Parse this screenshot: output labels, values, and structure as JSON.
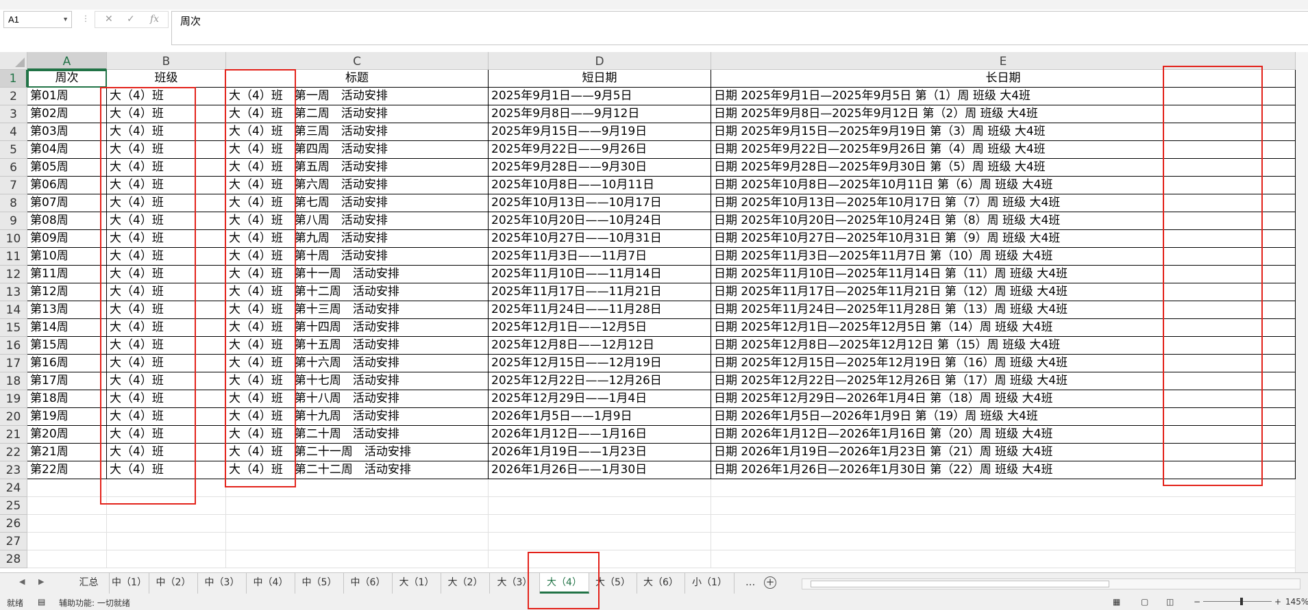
{
  "formula_bar": {
    "name_box": "A1",
    "cancel_icon": "✕",
    "enter_icon": "✓",
    "fx_label": "fx",
    "content": "周次"
  },
  "columns": [
    "A",
    "B",
    "C",
    "D",
    "E"
  ],
  "headers": {
    "a": "周次",
    "b": "班级",
    "c": "标题",
    "d": "短日期",
    "e": "长日期"
  },
  "rows": [
    {
      "a": "第01周",
      "b": "大（4）班",
      "c": "大（4）班　第一周　活动安排",
      "d": "2025年9月1日——9月5日",
      "e": "日期  2025年9月1日—2025年9月5日              第（1）周              班级     大4班"
    },
    {
      "a": "第02周",
      "b": "大（4）班",
      "c": "大（4）班　第二周　活动安排",
      "d": "2025年9月8日——9月12日",
      "e": "日期  2025年9月8日—2025年9月12日              第（2）周              班级     大4班"
    },
    {
      "a": "第03周",
      "b": "大（4）班",
      "c": "大（4）班　第三周　活动安排",
      "d": "2025年9月15日——9月19日",
      "e": "日期  2025年9月15日—2025年9月19日              第（3）周              班级     大4班"
    },
    {
      "a": "第04周",
      "b": "大（4）班",
      "c": "大（4）班　第四周　活动安排",
      "d": "2025年9月22日——9月26日",
      "e": "日期  2025年9月22日—2025年9月26日              第（4）周              班级     大4班"
    },
    {
      "a": "第05周",
      "b": "大（4）班",
      "c": "大（4）班　第五周　活动安排",
      "d": "2025年9月28日——9月30日",
      "e": "日期  2025年9月28日—2025年9月30日              第（5）周              班级     大4班"
    },
    {
      "a": "第06周",
      "b": "大（4）班",
      "c": "大（4）班　第六周　活动安排",
      "d": "2025年10月8日——10月11日",
      "e": "日期  2025年10月8日—2025年10月11日              第（6）周              班级     大4班"
    },
    {
      "a": "第07周",
      "b": "大（4）班",
      "c": "大（4）班　第七周　活动安排",
      "d": "2025年10月13日——10月17日",
      "e": "日期  2025年10月13日—2025年10月17日              第（7）周              班级     大4班"
    },
    {
      "a": "第08周",
      "b": "大（4）班",
      "c": "大（4）班　第八周　活动安排",
      "d": "2025年10月20日——10月24日",
      "e": "日期  2025年10月20日—2025年10月24日              第（8）周              班级     大4班"
    },
    {
      "a": "第09周",
      "b": "大（4）班",
      "c": "大（4）班　第九周　活动安排",
      "d": "2025年10月27日——10月31日",
      "e": "日期  2025年10月27日—2025年10月31日              第（9）周              班级     大4班"
    },
    {
      "a": "第10周",
      "b": "大（4）班",
      "c": "大（4）班　第十周　活动安排",
      "d": "2025年11月3日——11月7日",
      "e": "日期  2025年11月3日—2025年11月7日              第（10）周              班级     大4班"
    },
    {
      "a": "第11周",
      "b": "大（4）班",
      "c": "大（4）班　第十一周　活动安排",
      "d": "2025年11月10日——11月14日",
      "e": "日期  2025年11月10日—2025年11月14日              第（11）周              班级     大4班"
    },
    {
      "a": "第12周",
      "b": "大（4）班",
      "c": "大（4）班　第十二周　活动安排",
      "d": "2025年11月17日——11月21日",
      "e": "日期  2025年11月17日—2025年11月21日              第（12）周              班级     大4班"
    },
    {
      "a": "第13周",
      "b": "大（4）班",
      "c": "大（4）班　第十三周　活动安排",
      "d": "2025年11月24日——11月28日",
      "e": "日期  2025年11月24日—2025年11月28日              第（13）周              班级     大4班"
    },
    {
      "a": "第14周",
      "b": "大（4）班",
      "c": "大（4）班　第十四周　活动安排",
      "d": "2025年12月1日——12月5日",
      "e": "日期  2025年12月1日—2025年12月5日              第（14）周              班级     大4班"
    },
    {
      "a": "第15周",
      "b": "大（4）班",
      "c": "大（4）班　第十五周　活动安排",
      "d": "2025年12月8日——12月12日",
      "e": "日期  2025年12月8日—2025年12月12日              第（15）周              班级     大4班"
    },
    {
      "a": "第16周",
      "b": "大（4）班",
      "c": "大（4）班　第十六周　活动安排",
      "d": "2025年12月15日——12月19日",
      "e": "日期  2025年12月15日—2025年12月19日              第（16）周              班级     大4班"
    },
    {
      "a": "第17周",
      "b": "大（4）班",
      "c": "大（4）班　第十七周　活动安排",
      "d": "2025年12月22日——12月26日",
      "e": "日期  2025年12月22日—2025年12月26日              第（17）周              班级     大4班"
    },
    {
      "a": "第18周",
      "b": "大（4）班",
      "c": "大（4）班　第十八周　活动安排",
      "d": "2025年12月29日——1月4日",
      "e": "日期  2025年12月29日—2026年1月4日              第（18）周              班级     大4班"
    },
    {
      "a": "第19周",
      "b": "大（4）班",
      "c": "大（4）班　第十九周　活动安排",
      "d": "2026年1月5日——1月9日",
      "e": "日期  2026年1月5日—2026年1月9日              第（19）周              班级     大4班"
    },
    {
      "a": "第20周",
      "b": "大（4）班",
      "c": "大（4）班　第二十周　活动安排",
      "d": "2026年1月12日——1月16日",
      "e": "日期  2026年1月12日—2026年1月16日              第（20）周              班级     大4班"
    },
    {
      "a": "第21周",
      "b": "大（4）班",
      "c": "大（4）班　第二十一周　活动安排",
      "d": "2026年1月19日——1月23日",
      "e": "日期  2026年1月19日—2026年1月23日              第（21）周              班级     大4班"
    },
    {
      "a": "第22周",
      "b": "大（4）班",
      "c": "大（4）班　第二十二周　活动安排",
      "d": "2026年1月26日——1月30日",
      "e": "日期  2026年1月26日—2026年1月30日              第（22）周              班级     大4班"
    }
  ],
  "sheet_tabs": [
    "汇总",
    "中（1）",
    "中（2）",
    "中（3）",
    "中（4）",
    "中（5）",
    "中（6）",
    "大（1）",
    "大（2）",
    "大（3）",
    "大（4）",
    "大（5）",
    "大（6）",
    "小（1）"
  ],
  "active_tab": "大（4）",
  "tab_more": "...",
  "tab_add": "+",
  "status_bar": {
    "ready": "就绪",
    "accessibility": "辅助功能: 一切就绪",
    "zoom_minus": "−",
    "zoom_plus": "+",
    "zoom": "145%"
  },
  "colors": {
    "excel_green": "#217346",
    "highlight_red": "#e32119"
  }
}
